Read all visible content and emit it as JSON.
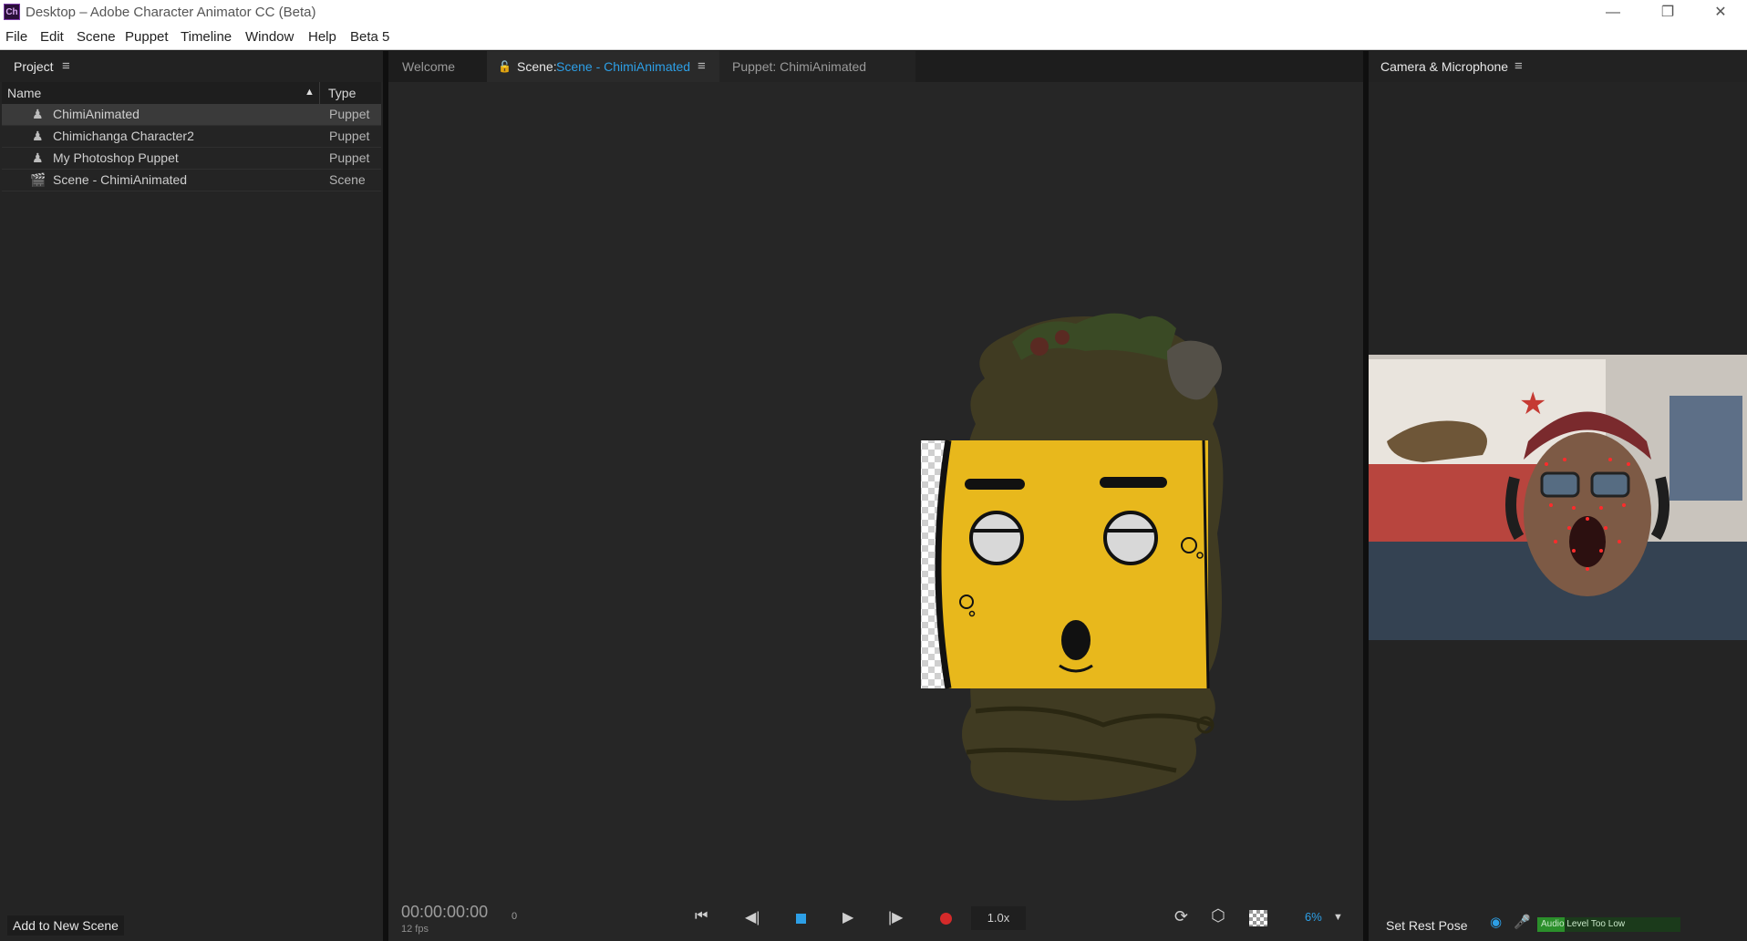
{
  "window": {
    "app_icon": "Ch",
    "title": "Desktop – Adobe Character Animator CC (Beta)",
    "controls": [
      "—",
      "❐",
      "✕"
    ]
  },
  "menu": [
    "File",
    "Edit",
    "Scene",
    "Puppet",
    "Timeline",
    "Window",
    "Help",
    "Beta 5"
  ],
  "project_panel": {
    "title": "Project",
    "columns": {
      "name": "Name",
      "type": "Type"
    },
    "items": [
      {
        "name": "ChimiAnimated",
        "type": "Puppet",
        "icon": "puppet-icon",
        "selected": true
      },
      {
        "name": "Chimichanga Character2",
        "type": "Puppet",
        "icon": "puppet-icon",
        "selected": false
      },
      {
        "name": "My Photoshop Puppet",
        "type": "Puppet",
        "icon": "puppet-icon",
        "selected": false
      },
      {
        "name": "Scene - ChimiAnimated",
        "type": "Scene",
        "icon": "clapperboard-icon",
        "selected": false
      }
    ],
    "add_button": "Add to New Scene"
  },
  "scene_panel": {
    "tabs": {
      "welcome": "Welcome",
      "scene_prefix": "Scene:",
      "scene_name": "Scene - ChimiAnimated",
      "puppet": "Puppet: ChimiAnimated"
    },
    "timecode": "00:00:00:00",
    "frame": "0",
    "fps": "12 fps",
    "speed": "1.0x",
    "zoom": "6%"
  },
  "camera_panel": {
    "title": "Camera & Microphone",
    "set_rest_pose": "Set Rest Pose",
    "audio_status": "Audio Level Too Low"
  },
  "colors": {
    "accent_blue": "#2d9fe6",
    "record_red": "#d42a2a",
    "face_yellow": "#e8b81c",
    "audio_green": "#1b6b1b"
  }
}
